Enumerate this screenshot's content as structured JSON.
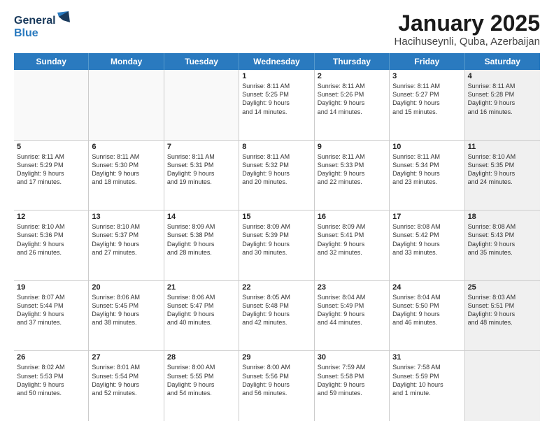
{
  "header": {
    "logo_general": "General",
    "logo_blue": "Blue",
    "title": "January 2025",
    "subtitle": "Hacihuseynli, Quba, Azerbaijan"
  },
  "weekdays": [
    "Sunday",
    "Monday",
    "Tuesday",
    "Wednesday",
    "Thursday",
    "Friday",
    "Saturday"
  ],
  "rows": [
    [
      {
        "day": "",
        "info": "",
        "shaded": false,
        "empty": true
      },
      {
        "day": "",
        "info": "",
        "shaded": false,
        "empty": true
      },
      {
        "day": "",
        "info": "",
        "shaded": false,
        "empty": true
      },
      {
        "day": "1",
        "info": "Sunrise: 8:11 AM\nSunset: 5:25 PM\nDaylight: 9 hours\nand 14 minutes.",
        "shaded": false,
        "empty": false
      },
      {
        "day": "2",
        "info": "Sunrise: 8:11 AM\nSunset: 5:26 PM\nDaylight: 9 hours\nand 14 minutes.",
        "shaded": false,
        "empty": false
      },
      {
        "day": "3",
        "info": "Sunrise: 8:11 AM\nSunset: 5:27 PM\nDaylight: 9 hours\nand 15 minutes.",
        "shaded": false,
        "empty": false
      },
      {
        "day": "4",
        "info": "Sunrise: 8:11 AM\nSunset: 5:28 PM\nDaylight: 9 hours\nand 16 minutes.",
        "shaded": true,
        "empty": false
      }
    ],
    [
      {
        "day": "5",
        "info": "Sunrise: 8:11 AM\nSunset: 5:29 PM\nDaylight: 9 hours\nand 17 minutes.",
        "shaded": false,
        "empty": false
      },
      {
        "day": "6",
        "info": "Sunrise: 8:11 AM\nSunset: 5:30 PM\nDaylight: 9 hours\nand 18 minutes.",
        "shaded": false,
        "empty": false
      },
      {
        "day": "7",
        "info": "Sunrise: 8:11 AM\nSunset: 5:31 PM\nDaylight: 9 hours\nand 19 minutes.",
        "shaded": false,
        "empty": false
      },
      {
        "day": "8",
        "info": "Sunrise: 8:11 AM\nSunset: 5:32 PM\nDaylight: 9 hours\nand 20 minutes.",
        "shaded": false,
        "empty": false
      },
      {
        "day": "9",
        "info": "Sunrise: 8:11 AM\nSunset: 5:33 PM\nDaylight: 9 hours\nand 22 minutes.",
        "shaded": false,
        "empty": false
      },
      {
        "day": "10",
        "info": "Sunrise: 8:11 AM\nSunset: 5:34 PM\nDaylight: 9 hours\nand 23 minutes.",
        "shaded": false,
        "empty": false
      },
      {
        "day": "11",
        "info": "Sunrise: 8:10 AM\nSunset: 5:35 PM\nDaylight: 9 hours\nand 24 minutes.",
        "shaded": true,
        "empty": false
      }
    ],
    [
      {
        "day": "12",
        "info": "Sunrise: 8:10 AM\nSunset: 5:36 PM\nDaylight: 9 hours\nand 26 minutes.",
        "shaded": false,
        "empty": false
      },
      {
        "day": "13",
        "info": "Sunrise: 8:10 AM\nSunset: 5:37 PM\nDaylight: 9 hours\nand 27 minutes.",
        "shaded": false,
        "empty": false
      },
      {
        "day": "14",
        "info": "Sunrise: 8:09 AM\nSunset: 5:38 PM\nDaylight: 9 hours\nand 28 minutes.",
        "shaded": false,
        "empty": false
      },
      {
        "day": "15",
        "info": "Sunrise: 8:09 AM\nSunset: 5:39 PM\nDaylight: 9 hours\nand 30 minutes.",
        "shaded": false,
        "empty": false
      },
      {
        "day": "16",
        "info": "Sunrise: 8:09 AM\nSunset: 5:41 PM\nDaylight: 9 hours\nand 32 minutes.",
        "shaded": false,
        "empty": false
      },
      {
        "day": "17",
        "info": "Sunrise: 8:08 AM\nSunset: 5:42 PM\nDaylight: 9 hours\nand 33 minutes.",
        "shaded": false,
        "empty": false
      },
      {
        "day": "18",
        "info": "Sunrise: 8:08 AM\nSunset: 5:43 PM\nDaylight: 9 hours\nand 35 minutes.",
        "shaded": true,
        "empty": false
      }
    ],
    [
      {
        "day": "19",
        "info": "Sunrise: 8:07 AM\nSunset: 5:44 PM\nDaylight: 9 hours\nand 37 minutes.",
        "shaded": false,
        "empty": false
      },
      {
        "day": "20",
        "info": "Sunrise: 8:06 AM\nSunset: 5:45 PM\nDaylight: 9 hours\nand 38 minutes.",
        "shaded": false,
        "empty": false
      },
      {
        "day": "21",
        "info": "Sunrise: 8:06 AM\nSunset: 5:47 PM\nDaylight: 9 hours\nand 40 minutes.",
        "shaded": false,
        "empty": false
      },
      {
        "day": "22",
        "info": "Sunrise: 8:05 AM\nSunset: 5:48 PM\nDaylight: 9 hours\nand 42 minutes.",
        "shaded": false,
        "empty": false
      },
      {
        "day": "23",
        "info": "Sunrise: 8:04 AM\nSunset: 5:49 PM\nDaylight: 9 hours\nand 44 minutes.",
        "shaded": false,
        "empty": false
      },
      {
        "day": "24",
        "info": "Sunrise: 8:04 AM\nSunset: 5:50 PM\nDaylight: 9 hours\nand 46 minutes.",
        "shaded": false,
        "empty": false
      },
      {
        "day": "25",
        "info": "Sunrise: 8:03 AM\nSunset: 5:51 PM\nDaylight: 9 hours\nand 48 minutes.",
        "shaded": true,
        "empty": false
      }
    ],
    [
      {
        "day": "26",
        "info": "Sunrise: 8:02 AM\nSunset: 5:53 PM\nDaylight: 9 hours\nand 50 minutes.",
        "shaded": false,
        "empty": false
      },
      {
        "day": "27",
        "info": "Sunrise: 8:01 AM\nSunset: 5:54 PM\nDaylight: 9 hours\nand 52 minutes.",
        "shaded": false,
        "empty": false
      },
      {
        "day": "28",
        "info": "Sunrise: 8:00 AM\nSunset: 5:55 PM\nDaylight: 9 hours\nand 54 minutes.",
        "shaded": false,
        "empty": false
      },
      {
        "day": "29",
        "info": "Sunrise: 8:00 AM\nSunset: 5:56 PM\nDaylight: 9 hours\nand 56 minutes.",
        "shaded": false,
        "empty": false
      },
      {
        "day": "30",
        "info": "Sunrise: 7:59 AM\nSunset: 5:58 PM\nDaylight: 9 hours\nand 59 minutes.",
        "shaded": false,
        "empty": false
      },
      {
        "day": "31",
        "info": "Sunrise: 7:58 AM\nSunset: 5:59 PM\nDaylight: 10 hours\nand 1 minute.",
        "shaded": false,
        "empty": false
      },
      {
        "day": "",
        "info": "",
        "shaded": true,
        "empty": true
      }
    ]
  ]
}
